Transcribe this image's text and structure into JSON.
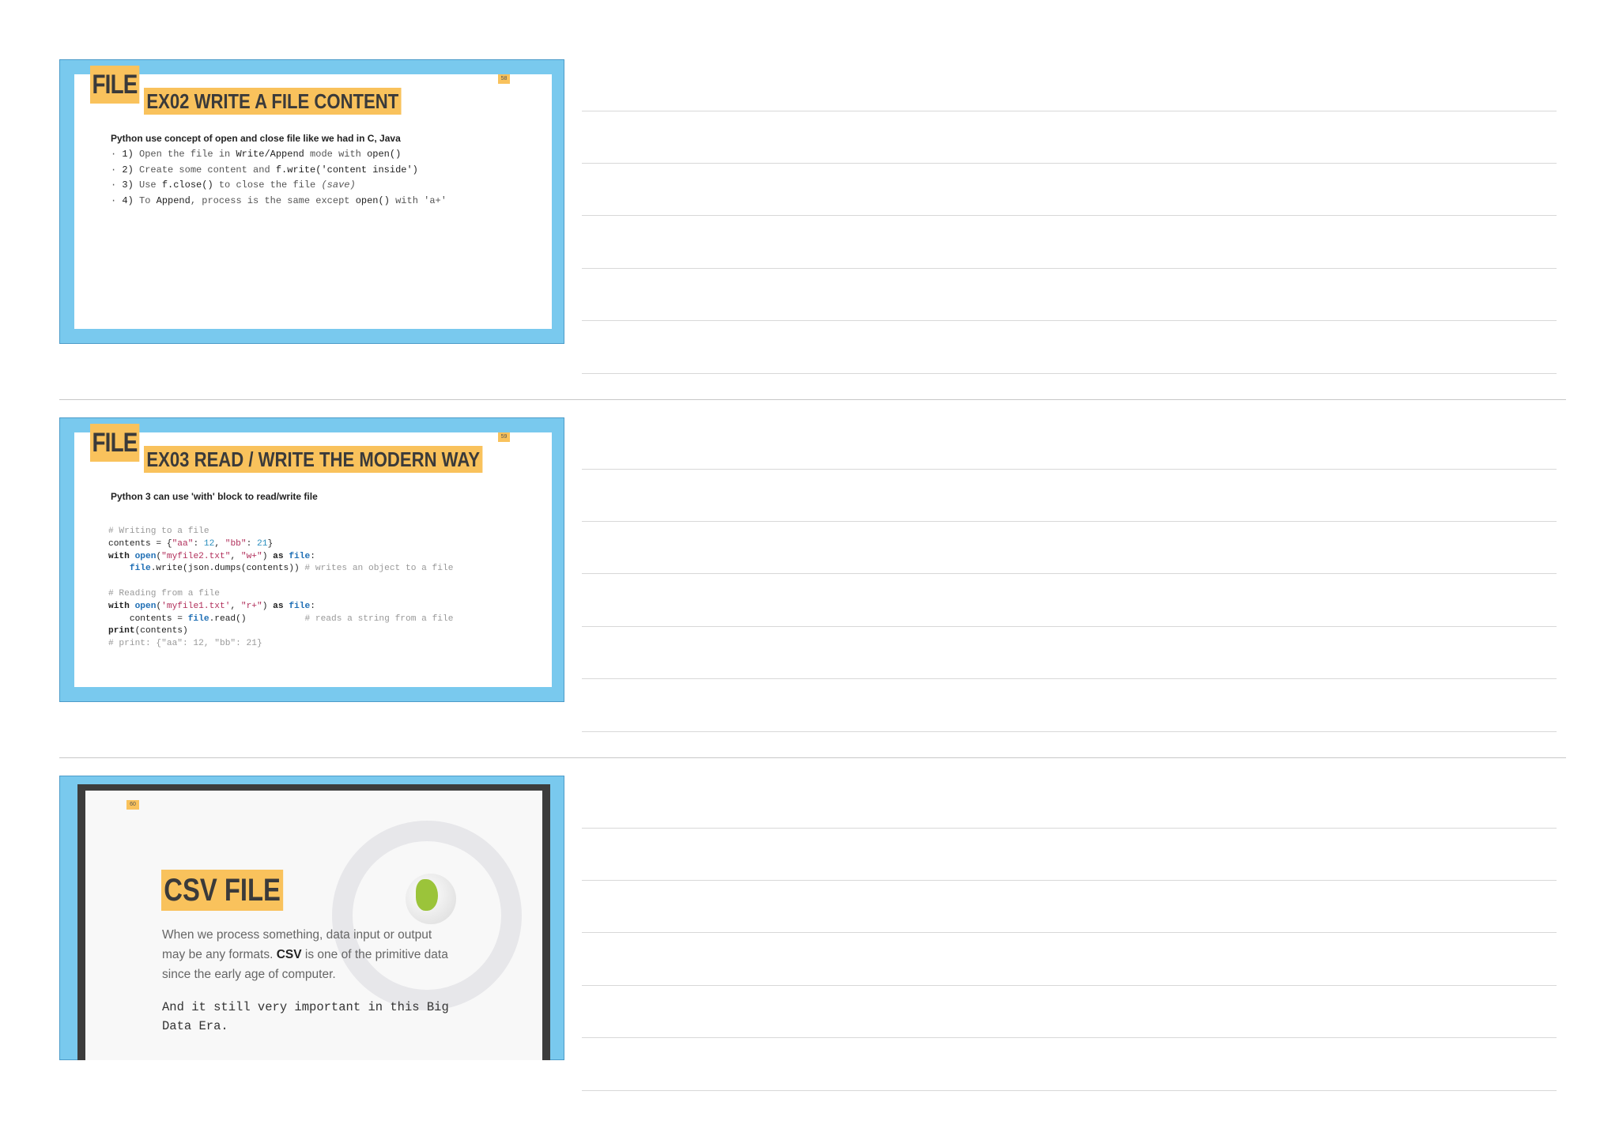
{
  "slides": [
    {
      "tag": "FILE",
      "title": "EX02 WRITE A FILE CONTENT",
      "page": "58",
      "lead": "Python use concept of open and close file like we had in C, Java",
      "bullets": [
        {
          "num": "1)",
          "pre": "Open the file in ",
          "b1": "Write/Append",
          "mid": " mode with ",
          "b2": "open()",
          "post": ""
        },
        {
          "num": "2)",
          "pre": "Create some content and ",
          "b1": "f.write('content inside')",
          "mid": "",
          "b2": "",
          "post": ""
        },
        {
          "num": "3)",
          "pre": "Use ",
          "b1": "f.close()",
          "mid": " to close the file ",
          "b2": "",
          "post": "(save)"
        },
        {
          "num": "4)",
          "pre": "To ",
          "b1": "Append",
          "mid": ", process is the same except ",
          "b2": "open()",
          "post": " with 'a+'"
        }
      ]
    },
    {
      "tag": "FILE",
      "title": "EX03 READ / WRITE THE MODERN WAY",
      "page": "59",
      "lead": "Python 3 can use 'with' block to read/write file"
    },
    {
      "page": "60",
      "title": "CSV FILE",
      "desc_1": "When we process something, data input or output may be any formats. ",
      "desc_bold": "CSV",
      "desc_2": " is one of the primitive data since the early age of computer.",
      "note": "And it still very important in this Big Data Era."
    }
  ]
}
